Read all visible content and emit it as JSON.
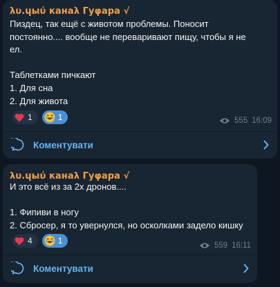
{
  "posts": [
    {
      "channel": "λυ.ɥыύ канаλ Гуφара √",
      "text": "Пиздец, так ещё с животом проблемы. Поносит\nпостоянно.... вообще не переваривают пищу, чтобы я не\nел.\n\nТаблетками пичкают\n1. Для сна\n2. Для живота",
      "reactions": [
        {
          "icon": "heart-icon",
          "emoji": "❤",
          "count": "1"
        },
        {
          "icon": "laughing-emoji-icon",
          "emoji": "😂",
          "count": "1"
        }
      ],
      "views": "555",
      "time": "16:09",
      "comments_label": "Коментувати"
    },
    {
      "channel": "λυ.ɥыύ канаλ Гуφара √",
      "text": "И это всё из за 2х дронов....\n\n1. Фипиви в ногу\n2. Сбросер, я то увернулся, но осколками задело кишку",
      "reactions": [
        {
          "icon": "heart-icon",
          "emoji": "❤",
          "count": "4"
        },
        {
          "icon": "laughing-emoji-icon",
          "emoji": "😂",
          "count": "1"
        }
      ],
      "views": "559",
      "time": "16:11",
      "comments_label": "Коментувати"
    }
  ],
  "colors": {
    "background": "#0e1621",
    "bubble": "#182533",
    "channel_name": "#f2a24a",
    "accent": "#64b5ef",
    "reaction_active": "#4a8fd5",
    "heart": "#e8384f"
  }
}
